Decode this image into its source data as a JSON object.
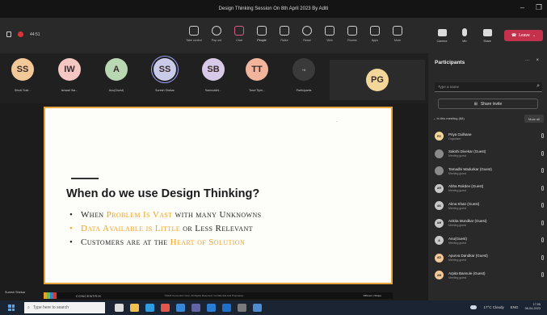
{
  "window": {
    "title": "Design Thinking Session On 8th April 2023 By Aditi",
    "minimize_glyph": "–",
    "maximize_glyph": "❐"
  },
  "toolbar": {
    "timer": "44:51",
    "items": [
      {
        "label": "Take control",
        "icon": "share-control-icon"
      },
      {
        "label": "Pop out",
        "icon": "pop-out-icon"
      },
      {
        "label": "Chat",
        "icon": "chat-icon"
      },
      {
        "label": "People",
        "icon": "people-icon"
      },
      {
        "label": "Raise",
        "icon": "raise-hand-icon"
      },
      {
        "label": "React",
        "icon": "react-icon"
      },
      {
        "label": "View",
        "icon": "view-icon"
      },
      {
        "label": "Rooms",
        "icon": "rooms-icon"
      },
      {
        "label": "Apps",
        "icon": "apps-icon"
      },
      {
        "label": "More",
        "icon": "more-icon"
      }
    ],
    "camera_label": "Camera",
    "mic_label": "Mic",
    "share_label": "Share",
    "leave_label": "Leave"
  },
  "strip": {
    "tiles": [
      {
        "initials": "SS",
        "name": "Shruti Suki...",
        "color": "#f3c99a"
      },
      {
        "initials": "IW",
        "name": "Ishwari Wa...",
        "color": "#f4c7c3"
      },
      {
        "initials": "A",
        "name": "Anu(Guest)",
        "color": "#b9d7b0"
      },
      {
        "initials": "SS",
        "name": "Suresh Shekar",
        "color": "#c9cbe8"
      },
      {
        "initials": "SB",
        "name": "Samruddhi...",
        "color": "#d9c9e8"
      },
      {
        "initials": "TT",
        "name": "Tanvi Tipni...",
        "color": "#f2b49a"
      },
      {
        "initials": "+6",
        "name": "Participants",
        "color": "#3a3a3a"
      }
    ],
    "pinned_initials": "PG",
    "pinned_color": "#f3d79a"
  },
  "slide": {
    "heading": "When do we use Design Thinking?",
    "bullet_glyph": "•",
    "bullets": [
      {
        "parts": [
          {
            "t": "When ",
            "hl": false
          },
          {
            "t": "Problem Is Vast",
            "hl": true
          },
          {
            "t": " with many Unknowns",
            "hl": false
          }
        ],
        "orange": false
      },
      {
        "parts": [
          {
            "t": "Data Available is Little",
            "hl": true
          },
          {
            "t": " or Less Relevant",
            "hl": false
          }
        ],
        "orange": false
      },
      {
        "parts": [
          {
            "t": "Customers are at the ",
            "hl": false
          },
          {
            "t": "Heart of Solution",
            "hl": true
          }
        ],
        "orange": false
      }
    ],
    "presenter": "Suresh Shekar",
    "logo_text": "CONCENTRIX",
    "copyright": "©2023 Concentrix Corp. All Rights Reserved. Confidential and Proprietary",
    "footer_right": "Different | Shape",
    "brand_colors": [
      "#f0a21f",
      "#6bbf4e",
      "#2f86d0",
      "#d8343a"
    ]
  },
  "panel": {
    "title": "Participants",
    "more_glyph": "···",
    "close_glyph": "×",
    "search_placeholder": "Type a name",
    "share_invite": "Share invite",
    "section": "In this meeting (68)",
    "mute_all": "Mute all",
    "people": [
      {
        "initials": "PG",
        "name": "Priya Gulhane",
        "role": "Organiser",
        "color": "#f3d79a"
      },
      {
        "initials": "",
        "name": "Sakshi Divekar (Guest)",
        "role": "Meeting guest",
        "color": "#8a8a8a"
      },
      {
        "initials": "",
        "name": "Tamadhi Wadurkar (Guest)",
        "role": "Meeting guest",
        "color": "#8a8a8a"
      },
      {
        "initials": "AR",
        "name": "Abha Rokdev (Guest)",
        "role": "Meeting guest",
        "color": "#c8c8c8"
      },
      {
        "initials": "AK",
        "name": "Alma Khan (Guest)",
        "role": "Meeting guest",
        "color": "#c8c8c8"
      },
      {
        "initials": "AM",
        "name": "Ankita Mundkar (Guest)",
        "role": "Meeting guest",
        "color": "#c8c8c8"
      },
      {
        "initials": "A",
        "name": "Anu(Guest)",
        "role": "Meeting guest",
        "color": "#c8c8c8"
      },
      {
        "initials": "AD",
        "name": "Apurva Dandkar (Guest)",
        "role": "Meeting guest",
        "color": "#f3c99a"
      },
      {
        "initials": "AB",
        "name": "Arpita Bansule (Guest)",
        "role": "Meeting guest",
        "color": "#f3c99a"
      }
    ]
  },
  "taskbar": {
    "search_placeholder": "Type here to search",
    "weather": "17°C Cloudy",
    "time": "17:05",
    "date": "08-04-2023",
    "lang": "ENG",
    "apps": [
      {
        "name": "task-view-icon",
        "color": "#dcdcdc"
      },
      {
        "name": "file-explorer-icon",
        "color": "#f2c14e"
      },
      {
        "name": "edge-icon",
        "color": "#2f9be0"
      },
      {
        "name": "chrome-icon",
        "color": "#e2574c"
      },
      {
        "name": "mail-icon",
        "color": "#3a86d6"
      },
      {
        "name": "teams-icon",
        "color": "#6264a7"
      },
      {
        "name": "word-icon",
        "color": "#2b7cd3"
      },
      {
        "name": "outlook-icon",
        "color": "#1e6fc9"
      },
      {
        "name": "store-icon",
        "color": "#7a7a7a"
      },
      {
        "name": "snip-icon",
        "color": "#4e8ccf"
      }
    ]
  }
}
